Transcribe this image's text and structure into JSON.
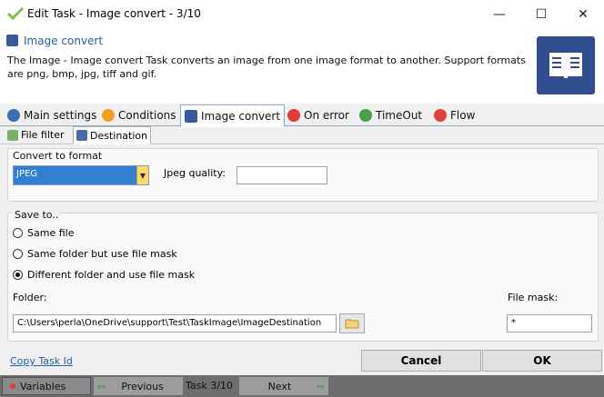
{
  "window": {
    "title": "Edit Task - Image convert - 3/10",
    "controls": {
      "minimize": "—",
      "maximize": "☐",
      "close": "✕"
    }
  },
  "header": {
    "title": "Image convert",
    "description": "The Image - Image convert Task converts an image from one image format to another. Support formats are png, bmp, jpg, tiff and gif."
  },
  "tabs": [
    {
      "label": "Main settings",
      "icon": "gear-icon",
      "color": "#3a6fb0"
    },
    {
      "label": "Conditions",
      "icon": "question-icon",
      "color": "#f0a020"
    },
    {
      "label": "Image convert",
      "icon": "book-icon",
      "color": "#3a5aa0",
      "active": true
    },
    {
      "label": "On error",
      "icon": "error-icon",
      "color": "#e03a3a"
    },
    {
      "label": "TimeOut",
      "icon": "timeout-icon",
      "color": "#4aa04a"
    },
    {
      "label": "Flow",
      "icon": "flow-icon",
      "color": "#e04040"
    }
  ],
  "subtabs": [
    {
      "label": "File filter",
      "icon": "file-filter-icon"
    },
    {
      "label": "Destination",
      "icon": "save-icon",
      "active": true
    }
  ],
  "convert": {
    "group_label": "Convert to format",
    "format_value": "JPEG",
    "quality_label": "Jpeg quality:",
    "quality_value": ""
  },
  "save_to": {
    "group_label": "Save to..",
    "options": [
      {
        "label": "Same file",
        "checked": false
      },
      {
        "label": "Same folder but use file mask",
        "checked": false
      },
      {
        "label": "Different folder and use file mask",
        "checked": true
      }
    ],
    "folder_label": "Folder:",
    "folder_value": "C:\\Users\\perla\\OneDrive\\support\\Test\\TaskImage\\ImageDestination",
    "mask_label": "File mask:",
    "mask_value": "*"
  },
  "footer": {
    "copy_link": "Copy Task Id",
    "cancel": "Cancel",
    "ok": "OK"
  },
  "bottom": {
    "variables": "Variables",
    "previous": "Previous",
    "task_indicator": "Task 3/10",
    "next": "Next"
  }
}
